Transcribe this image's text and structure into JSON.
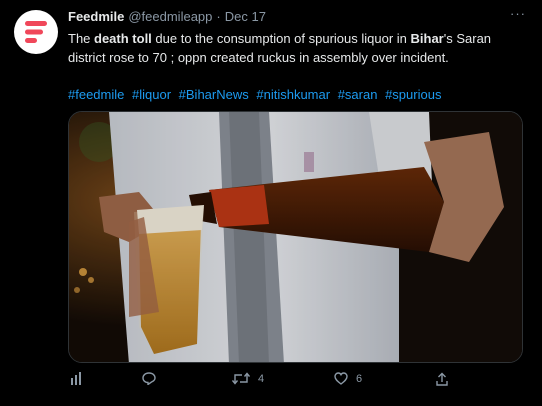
{
  "author": {
    "name": "Feedmile",
    "handle": "@feedmileapp",
    "separator": "·",
    "date": "Dec 17"
  },
  "more_label": "···",
  "tweet": {
    "seg1": "The ",
    "bold1": "death toll",
    "seg2": " due to the consumption of spurious liquor in ",
    "bold2": "Bihar",
    "seg3": "'s Saran district rose to 70 ; oppn created ruckus in assembly over incident."
  },
  "hashtags": [
    "#feedmile",
    "#liquor",
    "#BiharNews",
    "#nitishkumar",
    "#saran",
    "#spurious"
  ],
  "actions": {
    "retweets": "4",
    "likes": "6"
  },
  "colors": {
    "background": "#000000",
    "text": "#e7e9ea",
    "muted": "#8b98a5",
    "link": "#1d9bf0",
    "logo": "#f0475a"
  },
  "icons": {
    "avatar": "feedmile-logo",
    "views": "bar-chart-icon",
    "reply": "reply-bubble-icon",
    "retweet": "retweet-icon",
    "like": "heart-icon",
    "share": "share-icon"
  }
}
